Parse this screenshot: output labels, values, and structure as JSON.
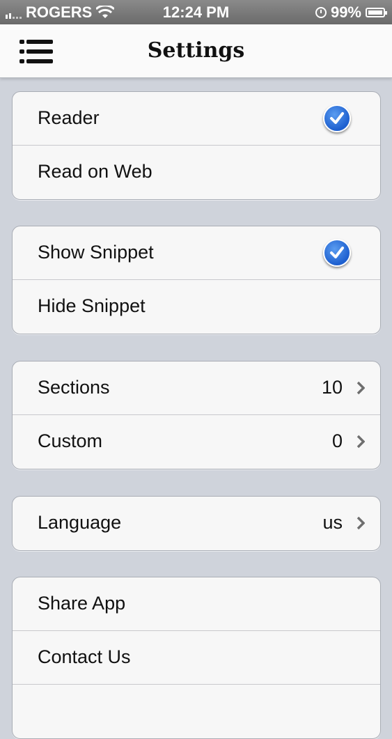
{
  "status_bar": {
    "carrier": "ROGERS",
    "time": "12:24 PM",
    "battery": "99%",
    "battery_level": 0.99,
    "icons": [
      "signal-icon",
      "wifi-icon",
      "clock-icon",
      "battery-charging-icon"
    ]
  },
  "nav": {
    "title": "Settings",
    "menu_icon": "list-menu-icon"
  },
  "groups": [
    {
      "rows": [
        {
          "label": "Reader",
          "checked": true
        },
        {
          "label": "Read on Web",
          "checked": false
        }
      ]
    },
    {
      "rows": [
        {
          "label": "Show Snippet",
          "checked": true
        },
        {
          "label": "Hide Snippet",
          "checked": false
        }
      ]
    },
    {
      "rows": [
        {
          "label": "Sections",
          "value": "10"
        },
        {
          "label": "Custom",
          "value": "0"
        }
      ]
    },
    {
      "rows": [
        {
          "label": "Language",
          "value": "us"
        }
      ]
    },
    {
      "rows": [
        {
          "label": "Share App"
        },
        {
          "label": "Contact Us"
        },
        {
          "label": ""
        }
      ]
    }
  ],
  "colors": {
    "background": "#cfd3db",
    "check_blue": "#1d5fcf",
    "chevron": "#6e6e6e"
  }
}
